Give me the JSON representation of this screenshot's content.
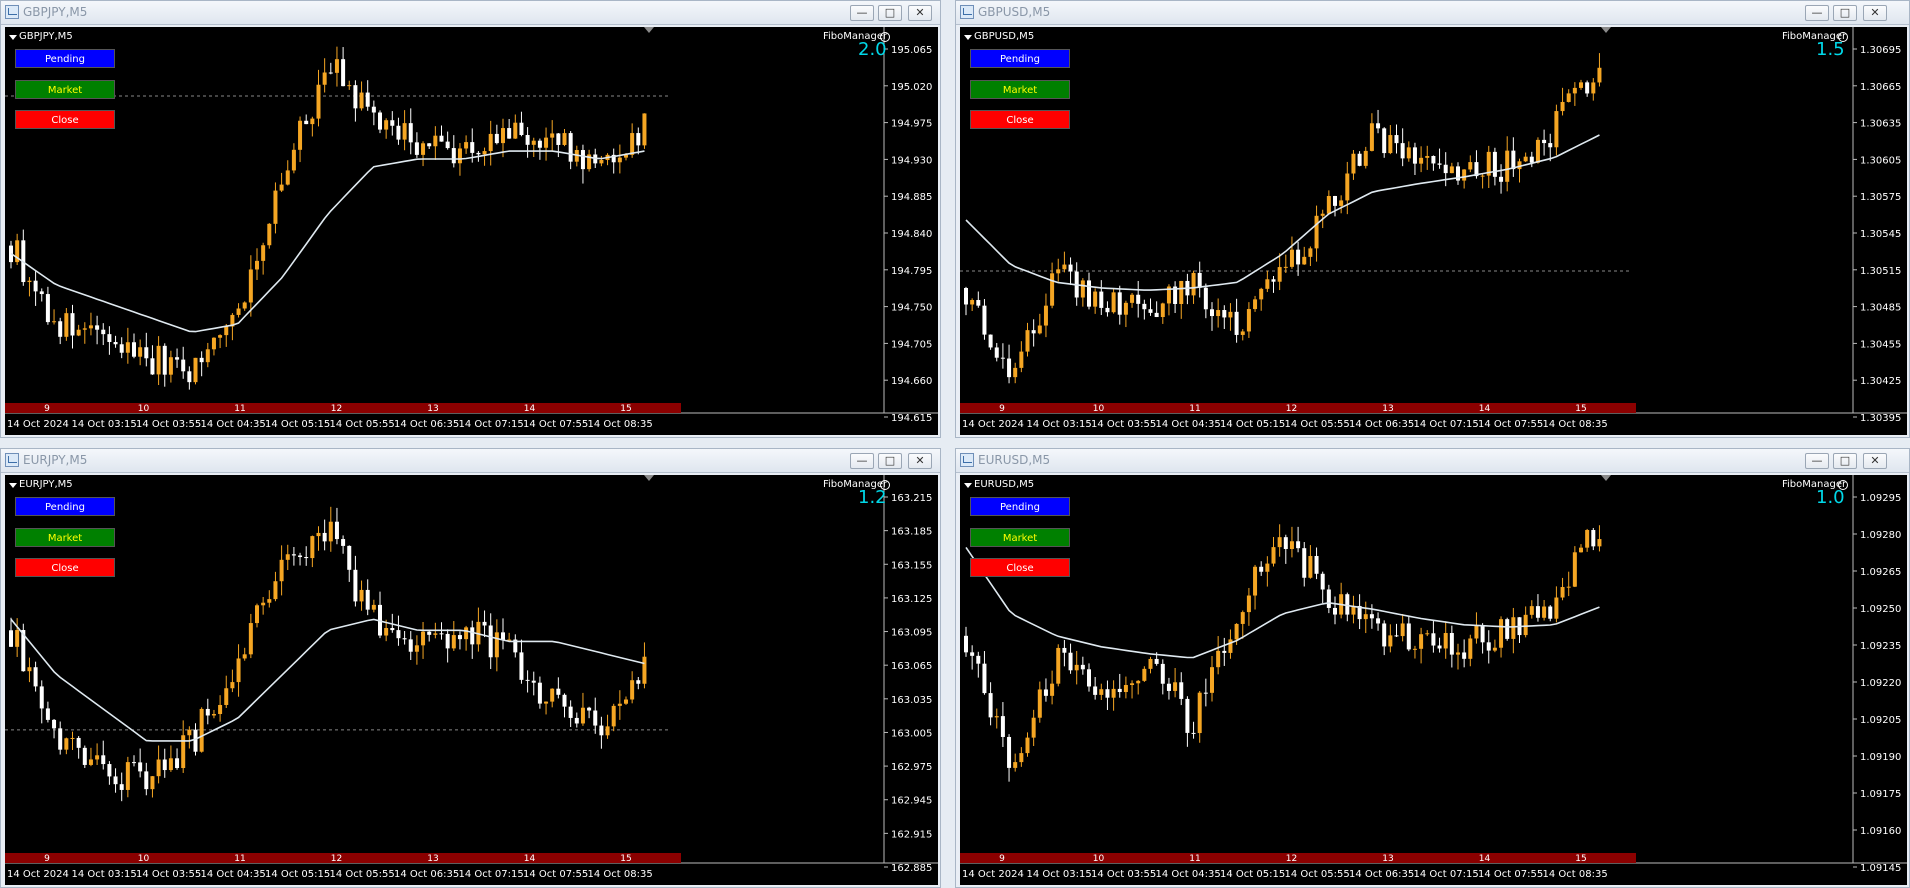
{
  "windows": [
    {
      "id": "gbpjpy",
      "title": "GBPJPY,M5",
      "symbol_label": "GBPJPY,M5",
      "ratio": "2.0",
      "indicator": "FiboManager",
      "price_labels": [
        "195.065",
        "195.020",
        "194.975",
        "194.930",
        "194.885",
        "194.840",
        "194.795",
        "194.750",
        "194.705",
        "194.660",
        "194.615"
      ],
      "time_labels": [
        "14 Oct 2024",
        "14 Oct 03:15",
        "14 Oct 03:55",
        "14 Oct 04:35",
        "14 Oct 05:15",
        "14 Oct 05:55",
        "14 Oct 06:35",
        "14 Oct 07:15",
        "14 Oct 07:55",
        "14 Oct 08:35"
      ],
      "period_labels": [
        "9",
        "10",
        "11",
        "12",
        "13",
        "14",
        "15"
      ]
    },
    {
      "id": "gbpusd",
      "title": "GBPUSD,M5",
      "symbol_label": "GBPUSD,M5",
      "ratio": "1.5",
      "indicator": "FiboManager",
      "price_labels": [
        "1.30695",
        "1.30665",
        "1.30635",
        "1.30605",
        "1.30575",
        "1.30545",
        "1.30515",
        "1.30485",
        "1.30455",
        "1.30425",
        "1.30395"
      ],
      "time_labels": [
        "14 Oct 2024",
        "14 Oct 03:15",
        "14 Oct 03:55",
        "14 Oct 04:35",
        "14 Oct 05:15",
        "14 Oct 05:55",
        "14 Oct 06:35",
        "14 Oct 07:15",
        "14 Oct 07:55",
        "14 Oct 08:35"
      ],
      "period_labels": [
        "9",
        "10",
        "11",
        "12",
        "13",
        "14",
        "15"
      ]
    },
    {
      "id": "eurjpy",
      "title": "EURJPY,M5",
      "symbol_label": "EURJPY,M5",
      "ratio": "1.2",
      "indicator": "FiboManager",
      "price_labels": [
        "163.215",
        "163.185",
        "163.155",
        "163.125",
        "163.095",
        "163.065",
        "163.035",
        "163.005",
        "162.975",
        "162.945",
        "162.915",
        "162.885"
      ],
      "time_labels": [
        "14 Oct 2024",
        "14 Oct 03:15",
        "14 Oct 03:55",
        "14 Oct 04:35",
        "14 Oct 05:15",
        "14 Oct 05:55",
        "14 Oct 06:35",
        "14 Oct 07:15",
        "14 Oct 07:55",
        "14 Oct 08:35"
      ],
      "period_labels": [
        "9",
        "10",
        "11",
        "12",
        "13",
        "14",
        "15"
      ]
    },
    {
      "id": "eurusd",
      "title": "EURUSD,M5",
      "symbol_label": "EURUSD,M5",
      "ratio": "1.0",
      "indicator": "FiboManager",
      "price_labels": [
        "1.09295",
        "1.09280",
        "1.09265",
        "1.09250",
        "1.09235",
        "1.09220",
        "1.09205",
        "1.09190",
        "1.09175",
        "1.09160",
        "1.09145"
      ],
      "time_labels": [
        "14 Oct 2024",
        "14 Oct 03:15",
        "14 Oct 03:55",
        "14 Oct 04:35",
        "14 Oct 05:15",
        "14 Oct 05:55",
        "14 Oct 06:35",
        "14 Oct 07:15",
        "14 Oct 07:55",
        "14 Oct 08:35"
      ],
      "period_labels": [
        "9",
        "10",
        "11",
        "12",
        "13",
        "14",
        "15"
      ]
    }
  ],
  "buttons": {
    "pending": "Pending",
    "market": "Market",
    "close": "Close"
  },
  "window_controls": {
    "minimize": "—",
    "maximize": "□",
    "close": "✕"
  },
  "colors": {
    "bull": "#f5a623",
    "bear": "#ffffff",
    "ma": "#dfe9f0",
    "period_bar": "#8b0000",
    "ratio": "#00d8e8"
  },
  "chart_data": [
    {
      "type": "candlestick",
      "symbol": "GBPJPY",
      "timeframe": "M5",
      "ylim": [
        194.615,
        195.09
      ],
      "x": [
        "14 Oct 2024",
        "14 Oct 03:15",
        "14 Oct 03:55",
        "14 Oct 04:35",
        "14 Oct 05:15",
        "14 Oct 05:55",
        "14 Oct 06:35",
        "14 Oct 07:15",
        "14 Oct 07:55",
        "14 Oct 08:35"
      ],
      "close_path": [
        194.82,
        194.72,
        194.7,
        194.68,
        194.66,
        194.74,
        194.9,
        195.05,
        194.98,
        194.95,
        194.94,
        194.96,
        194.95,
        194.92,
        194.97
      ],
      "ma_path": [
        194.81,
        194.77,
        194.75,
        194.73,
        194.71,
        194.72,
        194.78,
        194.86,
        194.92,
        194.93,
        194.93,
        194.94,
        194.94,
        194.93,
        194.94
      ],
      "dashed_level": 195.01
    },
    {
      "type": "candlestick",
      "symbol": "GBPUSD",
      "timeframe": "M5",
      "ylim": [
        1.30385,
        1.30715
      ],
      "x": [
        "14 Oct 2024",
        "14 Oct 03:15",
        "14 Oct 03:55",
        "14 Oct 04:35",
        "14 Oct 05:15",
        "14 Oct 05:55",
        "14 Oct 06:35",
        "14 Oct 07:15",
        "14 Oct 07:55",
        "14 Oct 08:35"
      ],
      "close_path": [
        1.3049,
        1.3042,
        1.305,
        1.3048,
        1.3047,
        1.3049,
        1.3046,
        1.305,
        1.3056,
        1.3063,
        1.306,
        1.3059,
        1.306,
        1.3063,
        1.3069
      ],
      "ma_path": [
        1.3055,
        1.3051,
        1.30495,
        1.3049,
        1.30488,
        1.3049,
        1.30495,
        1.3052,
        1.30555,
        1.30575,
        1.30582,
        1.30588,
        1.30595,
        1.30605,
        1.30625
      ],
      "dashed_level": 1.30505
    },
    {
      "type": "candlestick",
      "symbol": "EURJPY",
      "timeframe": "M5",
      "ylim": [
        162.885,
        163.225
      ],
      "x": [
        "14 Oct 2024",
        "14 Oct 03:15",
        "14 Oct 03:55",
        "14 Oct 04:35",
        "14 Oct 05:15",
        "14 Oct 05:55",
        "14 Oct 06:35",
        "14 Oct 07:15",
        "14 Oct 07:55",
        "14 Oct 08:35"
      ],
      "close_path": [
        163.09,
        162.99,
        162.96,
        162.96,
        162.99,
        163.06,
        163.15,
        163.18,
        163.1,
        163.08,
        163.09,
        163.07,
        163.02,
        163.0,
        163.06
      ],
      "ma_path": [
        163.1,
        163.05,
        163.02,
        162.99,
        162.99,
        163.01,
        163.05,
        163.09,
        163.1,
        163.09,
        163.09,
        163.08,
        163.08,
        163.07,
        163.06
      ],
      "dashed_level": 163.0
    },
    {
      "type": "candlestick",
      "symbol": "EURUSD",
      "timeframe": "M5",
      "ylim": [
        1.0914,
        1.0931
      ],
      "x": [
        "14 Oct 2024",
        "14 Oct 03:15",
        "14 Oct 03:55",
        "14 Oct 04:35",
        "14 Oct 05:15",
        "14 Oct 05:55",
        "14 Oct 06:35",
        "14 Oct 07:15",
        "14 Oct 07:55",
        "14 Oct 08:35"
      ],
      "close_path": [
        1.0924,
        1.0918,
        1.0923,
        1.0921,
        1.0923,
        1.092,
        1.0925,
        1.09285,
        1.0926,
        1.0924,
        1.0924,
        1.09235,
        1.09245,
        1.09255,
        1.0929
      ],
      "ma_path": [
        1.0928,
        1.0925,
        1.0924,
        1.09235,
        1.09232,
        1.0923,
        1.09238,
        1.0925,
        1.09255,
        1.09252,
        1.09248,
        1.09245,
        1.09244,
        1.09245,
        1.09253
      ],
      "dashed_level": null
    }
  ]
}
